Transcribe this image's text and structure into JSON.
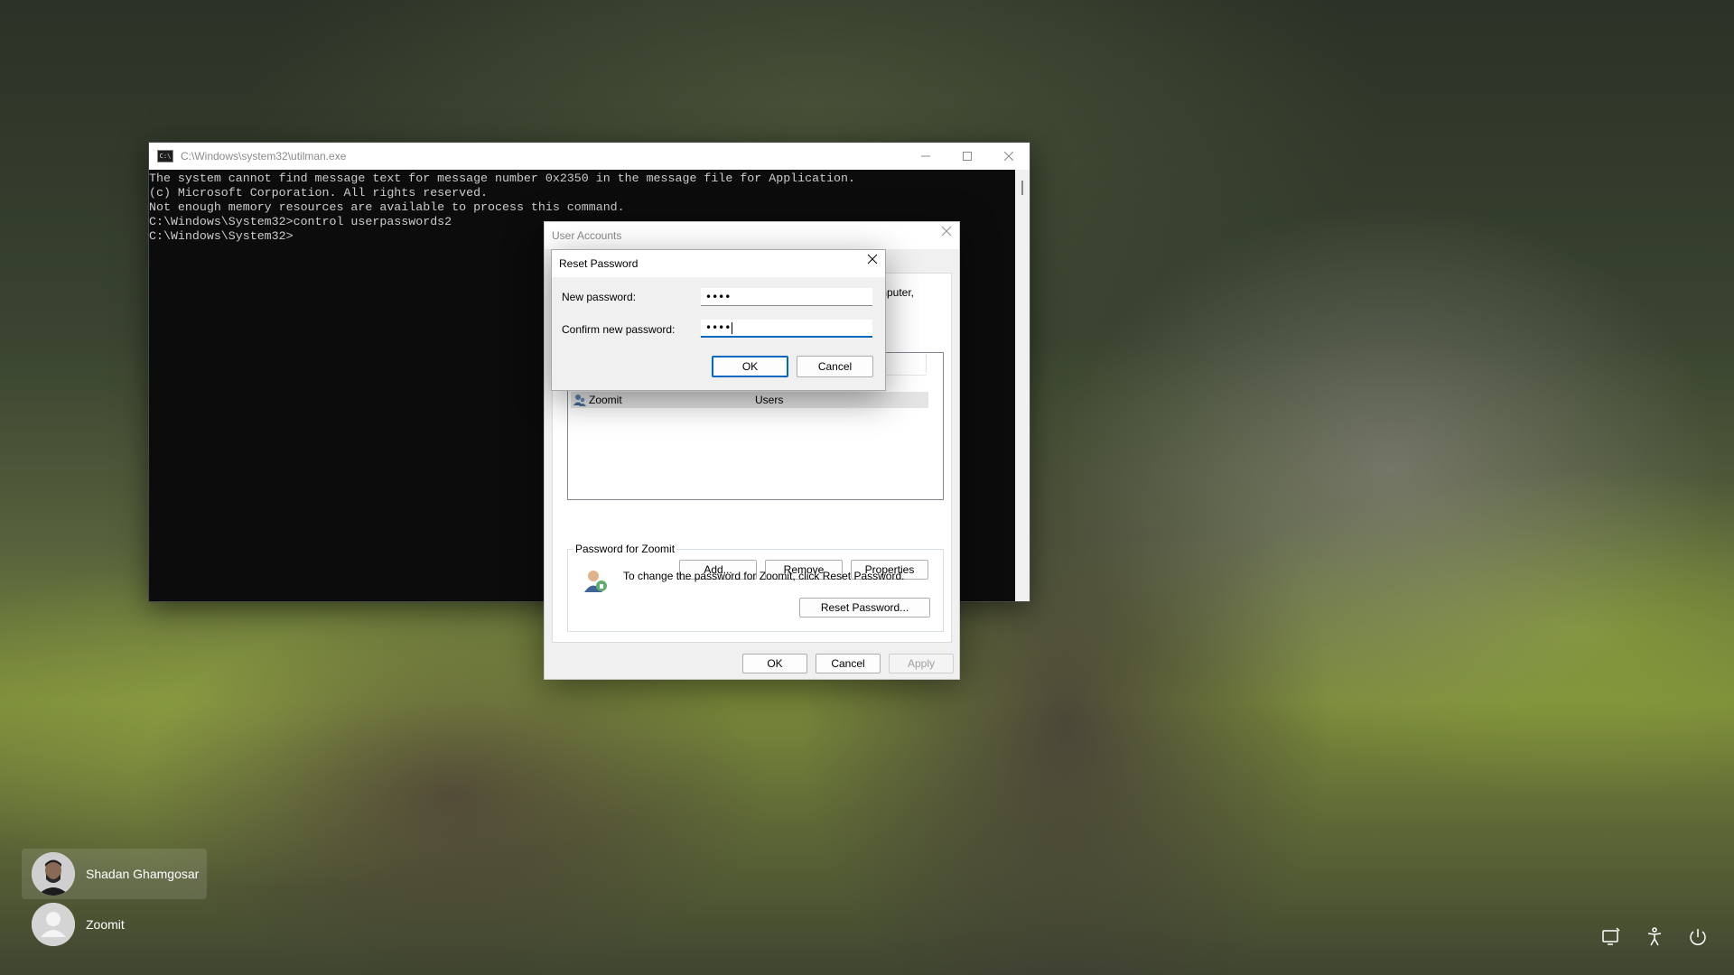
{
  "console": {
    "title": "C:\\Windows\\system32\\utilman.exe",
    "lines": [
      "The system cannot find message text for message number 0x2350 in the message file for Application.",
      "",
      "(c) Microsoft Corporation. All rights reserved.",
      "Not enough memory resources are available to process this command.",
      "",
      "C:\\Windows\\System32>control userpasswords2",
      "",
      "C:\\Windows\\System32>"
    ]
  },
  "user_accounts": {
    "title": "User Accounts",
    "partial_text": "mputer,",
    "users": [
      {
        "name": "Zoomit",
        "group": "Users"
      }
    ],
    "buttons": {
      "add": "Add...",
      "remove": "Remove",
      "properties": "Properties"
    },
    "password_group": {
      "label": "Password for Zoomit",
      "text": "To change the password for Zoomit, click Reset Password.",
      "reset_button": "Reset Password..."
    },
    "footer": {
      "ok": "OK",
      "cancel": "Cancel",
      "apply": "Apply"
    }
  },
  "reset_password": {
    "title": "Reset Password",
    "new_password_label": "New password:",
    "new_password_value": "••••",
    "confirm_label": "Confirm new password:",
    "confirm_value": "••••",
    "ok": "OK",
    "cancel": "Cancel"
  },
  "login": {
    "users": [
      {
        "name": "Shadan Ghamgosar",
        "selected": true
      },
      {
        "name": "Zoomit",
        "selected": false
      }
    ],
    "system_icons": [
      "network-icon",
      "accessibility-icon",
      "power-icon"
    ]
  },
  "colors": {
    "accent": "#0067c0",
    "console_bg": "#0c0c0c",
    "console_fg": "#cccccc"
  }
}
